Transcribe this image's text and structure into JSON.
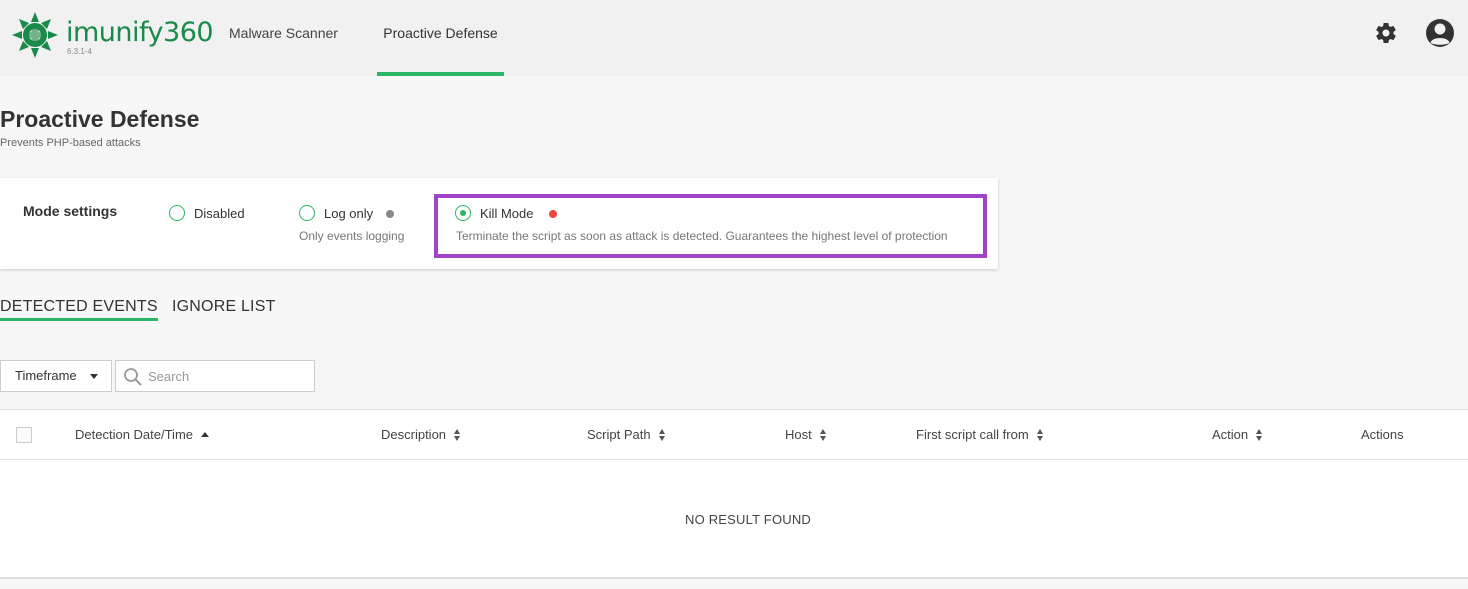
{
  "app": {
    "logo_text": "imunify360",
    "version": "6.3.1-4",
    "brand_color": "#1a8a4a",
    "accent_color": "#2db567"
  },
  "nav": {
    "tabs": [
      {
        "label": "Malware Scanner",
        "active": false
      },
      {
        "label": "Proactive Defense",
        "active": true
      }
    ],
    "icons": [
      "gear-icon",
      "user-avatar-icon"
    ]
  },
  "page": {
    "title": "Proactive Defense",
    "subtitle": "Prevents PHP-based attacks"
  },
  "mode_settings": {
    "label": "Mode settings",
    "options": [
      {
        "label": "Disabled",
        "description": "",
        "selected": false
      },
      {
        "label": "Log only",
        "description": "Only events logging",
        "selected": false,
        "dot_color": "#888888"
      },
      {
        "label": "Kill Mode",
        "description": "Terminate the script as soon as attack is detected. Guarantees the highest level of protection",
        "selected": true,
        "dot_color": "#f0463c"
      }
    ],
    "highlight_color": "#a044c7"
  },
  "subtabs": [
    {
      "label": "DETECTED EVENTS",
      "active": true
    },
    {
      "label": "IGNORE LIST",
      "active": false
    }
  ],
  "filters": {
    "timeframe_label": "Timeframe",
    "search_placeholder": "Search"
  },
  "table": {
    "columns": [
      {
        "label": "Detection Date/Time",
        "sort": "asc"
      },
      {
        "label": "Description",
        "sort": "both"
      },
      {
        "label": "Script Path",
        "sort": "both"
      },
      {
        "label": "Host",
        "sort": "both"
      },
      {
        "label": "First script call from",
        "sort": "both"
      },
      {
        "label": "Action",
        "sort": "both"
      },
      {
        "label": "Actions",
        "sort": "none"
      }
    ],
    "empty_text": "NO RESULT FOUND"
  }
}
